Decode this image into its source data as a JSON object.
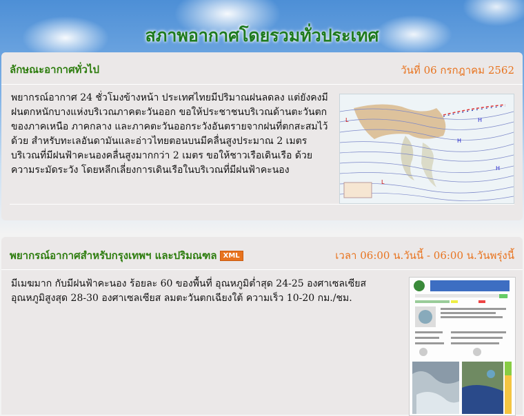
{
  "page_title": "สภาพอากาศโดยรวมทั่วประเทศ",
  "general": {
    "title": "ลักษณะอากาศทั่วไป",
    "date": "วันที่ 06 กรกฎาคม 2562",
    "description": "พยากรณ์อากาศ 24 ชั่วโมงข้างหน้า ประเทศไทยมีปริมาณฝนลดลง แต่ยังคงมีฝนตกหนักบางแห่งบริเวณภาคตะวันออก ขอให้ประชาชนบริเวณด้านตะวันตกของภาคเหนือ ภาคกลาง และภาคตะวันออกระวังอันตรายจากฝนที่ตกสะสมไว้ด้วย สำหรับทะเลอันดามันและอ่าวไทยตอนบนมีคลื่นสูงประมาณ 2 เมตร บริเวณที่มีฝนฟ้าคะนองคลื่นสูงมากกว่า 2 เมตร ขอให้ชาวเรือเดินเรือ ด้วยความระมัดระวัง โดยหลีกเลี่ยงการเดินเรือในบริเวณที่มีฝนฟ้าคะนอง"
  },
  "bangkok": {
    "title": "พยากรณ์อากาศสำหรับกรุงเทพฯ และปริมณฑล",
    "xml_label": "XML",
    "time_range": "เวลา 06:00 น.วันนี้ - 06:00 น.วันพรุ่งนี้",
    "description": "มีเมฆมาก กับมีฝนฟ้าคะนอง ร้อยละ 60 ของพื้นที่ อุณหภูมิต่ำสุด 24-25 องศาเซลเซียส อุณหภูมิสูงสุด 28-30 องศาเซลเซียส ลมตะวันตกเฉียงใต้ ความเร็ว 10-20 กม./ชม."
  }
}
